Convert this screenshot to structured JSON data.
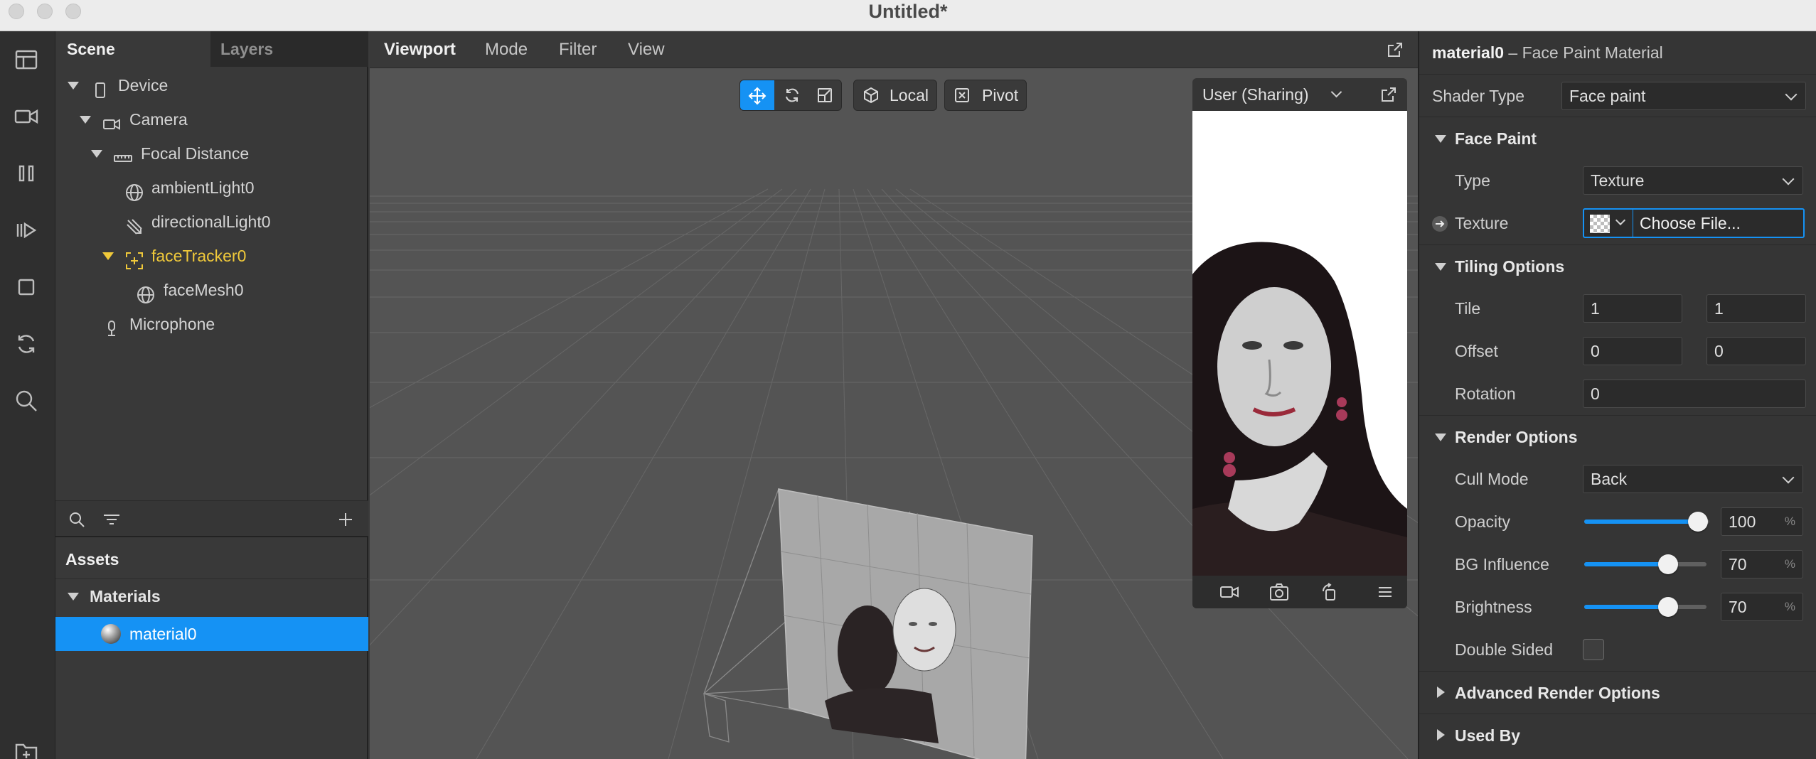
{
  "window": {
    "title": "Untitled*"
  },
  "scene_panel": {
    "tabs": [
      "Scene",
      "Layers"
    ],
    "tree": [
      {
        "label": "Device",
        "icon": "phone-icon"
      },
      {
        "label": "Camera",
        "icon": "camera-icon"
      },
      {
        "label": "Focal Distance",
        "icon": "ruler-icon"
      },
      {
        "label": "ambientLight0",
        "icon": "globe-icon"
      },
      {
        "label": "directionalLight0",
        "icon": "directional-light-icon"
      },
      {
        "label": "faceTracker0",
        "icon": "face-tracker-icon"
      },
      {
        "label": "faceMesh0",
        "icon": "globe-icon"
      },
      {
        "label": "Microphone",
        "icon": "microphone-icon"
      }
    ],
    "assets": {
      "title": "Assets",
      "group": "Materials",
      "items": [
        "material0"
      ]
    }
  },
  "viewport": {
    "menu": [
      "Viewport",
      "Mode",
      "Filter",
      "View"
    ],
    "tools": {
      "local": "Local",
      "pivot": "Pivot"
    },
    "preview": {
      "device": "User (Sharing)"
    }
  },
  "inspector": {
    "title": "material0",
    "subtitle": "– Face Paint Material",
    "shader_type": {
      "label": "Shader Type",
      "value": "Face paint"
    },
    "face_paint": {
      "section": "Face Paint",
      "type_label": "Type",
      "type_value": "Texture",
      "texture_label": "Texture",
      "texture_button": "Choose File..."
    },
    "tiling": {
      "section": "Tiling Options",
      "tile_label": "Tile",
      "tile_x": "1",
      "tile_y": "1",
      "offset_label": "Offset",
      "offset_x": "0",
      "offset_y": "0",
      "rotation_label": "Rotation",
      "rotation": "0"
    },
    "render": {
      "section": "Render Options",
      "cull_label": "Cull Mode",
      "cull_value": "Back",
      "opacity_label": "Opacity",
      "opacity": "100",
      "bg_label": "BG Influence",
      "bg": "70",
      "brightness_label": "Brightness",
      "brightness": "70",
      "double_sided_label": "Double Sided",
      "unit": "%"
    },
    "advanced": "Advanced Render Options",
    "used_by": "Used By"
  },
  "colors": {
    "accent": "#1592f4",
    "highlight": "#f0c93a"
  }
}
